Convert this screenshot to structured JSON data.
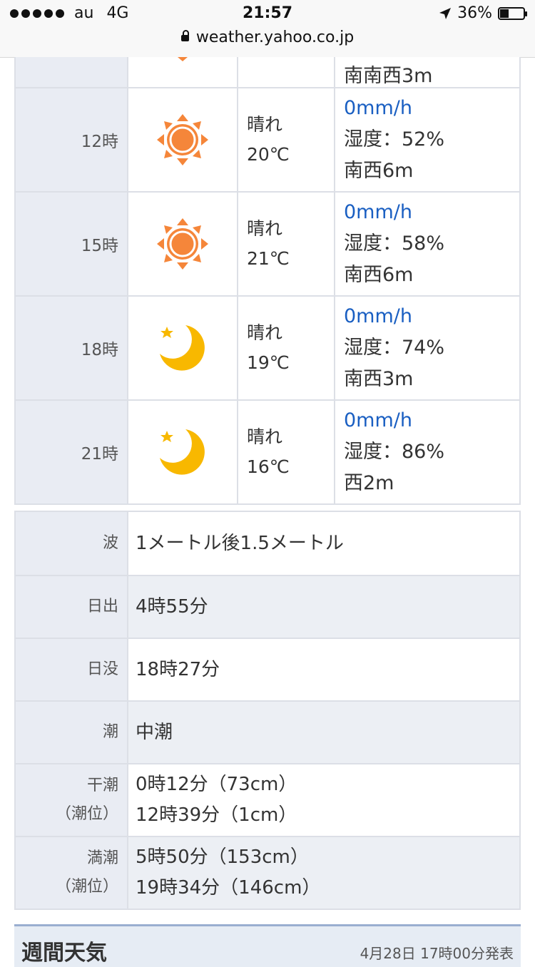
{
  "status_bar": {
    "carrier": "au",
    "network": "4G",
    "time": "21:57",
    "battery": "36%",
    "battery_level": 0.36
  },
  "url_bar": {
    "domain": "weather.yahoo.co.jp"
  },
  "hourly": {
    "partial_row": {
      "detail_wind": "南南西3m"
    },
    "rows": [
      {
        "time": "12時",
        "icon": "sun-icon",
        "condition": "晴れ",
        "temp": "20℃",
        "rain": "0mm/h",
        "humidity": "湿度：52%",
        "wind": "南西6m"
      },
      {
        "time": "15時",
        "icon": "sun-icon",
        "condition": "晴れ",
        "temp": "21℃",
        "rain": "0mm/h",
        "humidity": "湿度：58%",
        "wind": "南西6m"
      },
      {
        "time": "18時",
        "icon": "moon-icon",
        "condition": "晴れ",
        "temp": "19℃",
        "rain": "0mm/h",
        "humidity": "湿度：74%",
        "wind": "南西3m"
      },
      {
        "time": "21時",
        "icon": "moon-icon",
        "condition": "晴れ",
        "temp": "16℃",
        "rain": "0mm/h",
        "humidity": "湿度：86%",
        "wind": "西2m"
      }
    ]
  },
  "info": {
    "wave": {
      "label": "波",
      "value": "1メートル後1.5メートル"
    },
    "sunrise": {
      "label": "日出",
      "value": "4時55分"
    },
    "sunset": {
      "label": "日没",
      "value": "18時27分"
    },
    "tide": {
      "label": "潮",
      "value": "中潮"
    },
    "low_tide": {
      "label1": "干潮",
      "label2": "（潮位）",
      "value1": "0時12分（73cm）",
      "value2": "12時39分（1cm）"
    },
    "high_tide": {
      "label1": "満潮",
      "label2": "（潮位）",
      "value1": "5時50分（153cm）",
      "value2": "19時34分（146cm）"
    }
  },
  "weekly": {
    "title": "週間天気",
    "published": "4月28日 17時00分発表"
  },
  "colors": {
    "sun": "#f5863a",
    "moon": "#f8b800",
    "rain": "#1a5fc2",
    "label_bg": "#e9ecf3"
  }
}
